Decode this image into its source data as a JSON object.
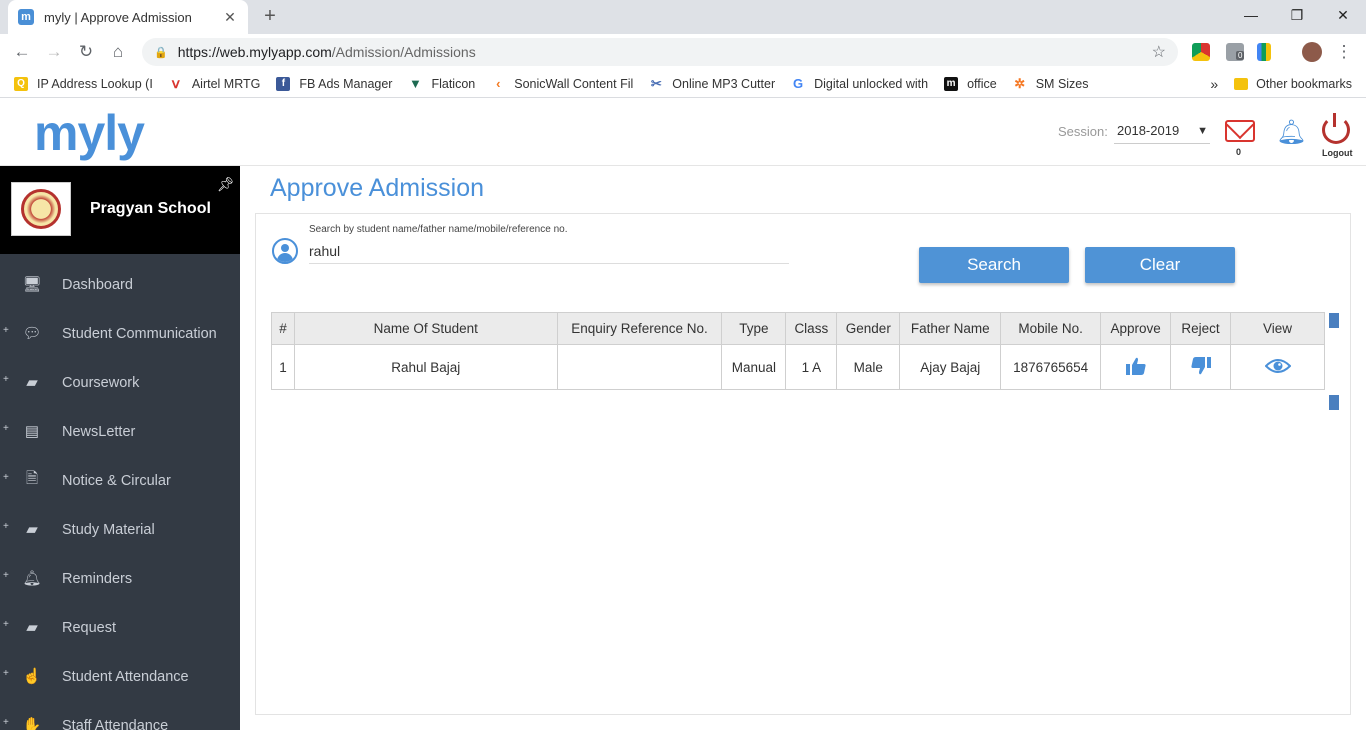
{
  "browser": {
    "tab_title": "myly | Approve Admission",
    "favicon_letter": "m",
    "url_host": "https://web.mylyapp.com",
    "url_path": "/Admission/Admissions",
    "bookmarks": [
      {
        "label": "IP Address Lookup (I",
        "icon": "yellow-square-icon",
        "color": "#f4c20d"
      },
      {
        "label": "Airtel MRTG",
        "icon": "airtel-icon",
        "color": "#d9352f"
      },
      {
        "label": "FB Ads Manager",
        "icon": "facebook-icon",
        "color": "#3b5998"
      },
      {
        "label": "Flaticon",
        "icon": "flaticon-icon",
        "color": "#1e6b52"
      },
      {
        "label": "SonicWall Content Fil",
        "icon": "sonicwall-icon",
        "color": "#f47920"
      },
      {
        "label": "Online MP3 Cutter",
        "icon": "scissors-icon",
        "color": "#4a6fb5"
      },
      {
        "label": "Digital unlocked with",
        "icon": "google-icon",
        "color": "#4285f4"
      },
      {
        "label": "office",
        "icon": "office-icon",
        "color": "#111111"
      },
      {
        "label": "SM Sizes",
        "icon": "hubspot-icon",
        "color": "#f57722"
      }
    ],
    "other_bookmarks": "Other bookmarks",
    "more_bookmarks": "»",
    "ext_badge": "0"
  },
  "header": {
    "logo": "myly",
    "session_label": "Session:",
    "session_value": "2018-2019",
    "mail_count": "0",
    "logout_label": "Logout"
  },
  "sidebar": {
    "school_name": "Pragyan School",
    "items": [
      {
        "label": "Dashboard",
        "icon": "monitor-icon",
        "expandable": false
      },
      {
        "label": "Student Communication",
        "icon": "chat-icon",
        "expandable": true
      },
      {
        "label": "Coursework",
        "icon": "book-icon",
        "expandable": true
      },
      {
        "label": "NewsLetter",
        "icon": "newspaper-icon",
        "expandable": true
      },
      {
        "label": "Notice & Circular",
        "icon": "document-icon",
        "expandable": true
      },
      {
        "label": "Study Material",
        "icon": "book-icon",
        "expandable": true
      },
      {
        "label": "Reminders",
        "icon": "bell-icon",
        "expandable": true
      },
      {
        "label": "Request",
        "icon": "book-icon",
        "expandable": true
      },
      {
        "label": "Student Attendance",
        "icon": "hand-icon",
        "expandable": true
      },
      {
        "label": "Staff Attendance",
        "icon": "hand-icon",
        "expandable": true
      }
    ]
  },
  "main": {
    "title": "Approve Admission",
    "search": {
      "label": "Search by student name/father name/mobile/reference no.",
      "value": "rahul"
    },
    "buttons": {
      "search": "Search",
      "clear": "Clear"
    },
    "table": {
      "columns": [
        "#",
        "Name Of Student",
        "Enquiry Reference No.",
        "Type",
        "Class",
        "Gender",
        "Father Name",
        "Mobile No.",
        "Approve",
        "Reject",
        "View"
      ],
      "rows": [
        {
          "num": "1",
          "name": "Rahul Bajaj",
          "enquiry_ref": "",
          "type": "Manual",
          "class": "1 A",
          "gender": "Male",
          "father": "Ajay Bajaj",
          "mobile": "1876765654"
        }
      ]
    }
  },
  "colors": {
    "accent": "#4a90d9",
    "sidebar_bg": "#333a44",
    "button_bg": "#4f93d6",
    "logout_red": "#b5322e"
  }
}
